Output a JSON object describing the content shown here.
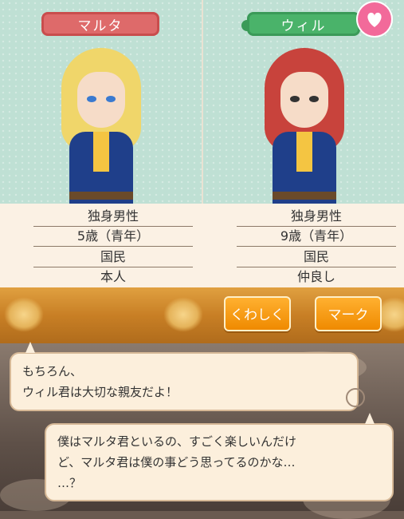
{
  "characters": {
    "left": {
      "name": "マルタ",
      "stats": [
        "独身男性",
        "5歳（青年）",
        "国民",
        "本人"
      ],
      "hair_color": "#f0d66a",
      "eye_color": "#3a7ad0"
    },
    "right": {
      "name": "ウィル",
      "stats": [
        "独身男性",
        "9歳（青年）",
        "国民",
        "仲良し"
      ],
      "hair_color": "#c8433c",
      "eye_color": "#333333"
    }
  },
  "buttons": {
    "details": "くわしく",
    "mark": "マーク"
  },
  "dialogue": {
    "first": [
      "もちろん、",
      "ウィル君は大切な親友だよ！"
    ],
    "second": [
      "僕はマルタ君といるの、すごく楽しいんだけ",
      "ど、マルタ君は僕の事どう思ってるのかな…",
      "…？"
    ]
  },
  "icons": {
    "heart": "heart-icon",
    "speech": "speech-bubble-icon"
  },
  "colors": {
    "left_plate": "#de6a6a",
    "right_plate": "#4ab36a",
    "button": "#ef8a00",
    "heart": "#f26a9a"
  }
}
